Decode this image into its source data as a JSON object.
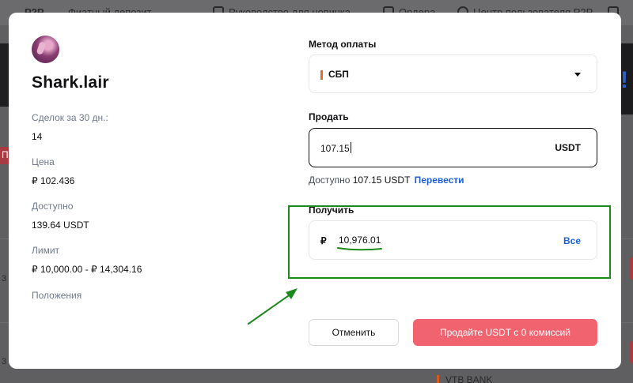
{
  "background_page": {
    "nav": {
      "p2p": "P2P",
      "fiat_deposit": "Фиатный депозит",
      "guide": "Руководство для новичка",
      "orders": "Ордера",
      "user_center": "Центр пользователя P2P"
    },
    "left_button_letter": "П",
    "row_marker_1": "3",
    "row_marker_2": "3",
    "bank_label": "VTB BANK"
  },
  "seller": {
    "name": "Shark.lair",
    "deals_label": "Сделок за 30 дн.:",
    "deals_value": "14",
    "price_label": "Цена",
    "price_value": "₽ 102.436",
    "available_label": "Доступно",
    "available_value": "139.64 USDT",
    "limit_label": "Лимит",
    "limit_value": "₽ 10,000.00 - ₽ 14,304.16",
    "terms_label": "Положения"
  },
  "form": {
    "payment_method_label": "Метод оплаты",
    "payment_method_value": "СБП",
    "sell_label": "Продать",
    "sell_value": "107.15",
    "sell_unit": "USDT",
    "available_text": "Доступно",
    "available_amount": "107.15 USDT",
    "transfer_link": "Перевести",
    "receive_label": "Получить",
    "receive_currency": "₽",
    "receive_value": "10,976.01",
    "all_button": "Все"
  },
  "buttons": {
    "cancel": "Отменить",
    "sell": "Продайте USDT с 0 комиссий"
  },
  "colors": {
    "annotation": "#1d8a1d",
    "sell_button": "#f0636f",
    "link": "#1d5fd6",
    "payment_accent": "#e76a2d"
  }
}
